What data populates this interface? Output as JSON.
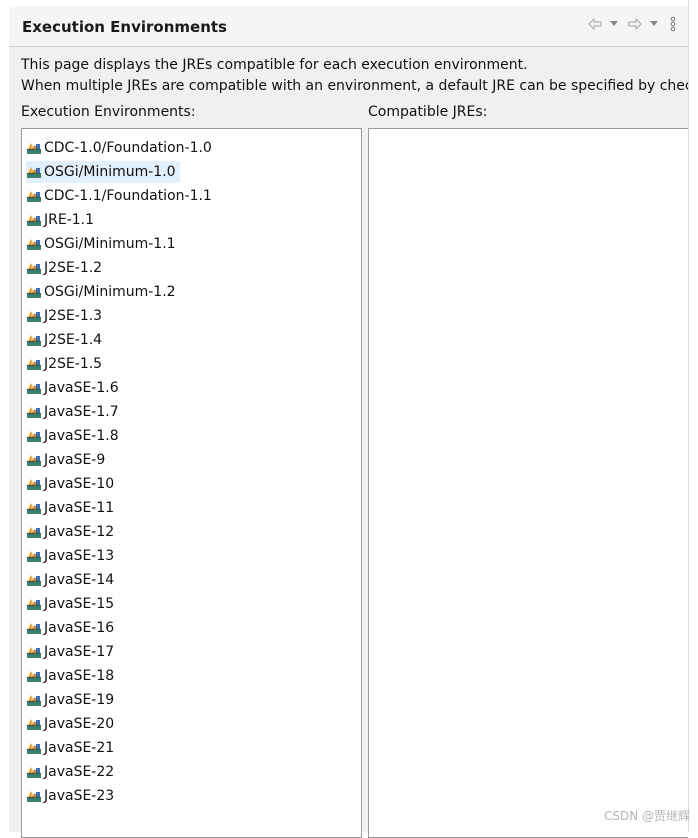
{
  "header": {
    "title": "Execution Environments"
  },
  "description": {
    "line1": "This page displays the JREs compatible for each execution environment.",
    "line2": "When multiple JREs are compatible with an environment, a default JRE can be specified by checking"
  },
  "environments_label": "Execution Environments:",
  "jres_label": "Compatible JREs:",
  "environments": [
    {
      "label": "CDC-1.0/Foundation-1.0",
      "selected": false
    },
    {
      "label": "OSGi/Minimum-1.0",
      "selected": true
    },
    {
      "label": "CDC-1.1/Foundation-1.1",
      "selected": false
    },
    {
      "label": "JRE-1.1",
      "selected": false
    },
    {
      "label": "OSGi/Minimum-1.1",
      "selected": false
    },
    {
      "label": "J2SE-1.2",
      "selected": false
    },
    {
      "label": "OSGi/Minimum-1.2",
      "selected": false
    },
    {
      "label": "J2SE-1.3",
      "selected": false
    },
    {
      "label": "J2SE-1.4",
      "selected": false
    },
    {
      "label": "J2SE-1.5",
      "selected": false
    },
    {
      "label": "JavaSE-1.6",
      "selected": false
    },
    {
      "label": "JavaSE-1.7",
      "selected": false
    },
    {
      "label": "JavaSE-1.8",
      "selected": false
    },
    {
      "label": "JavaSE-9",
      "selected": false
    },
    {
      "label": "JavaSE-10",
      "selected": false
    },
    {
      "label": "JavaSE-11",
      "selected": false
    },
    {
      "label": "JavaSE-12",
      "selected": false
    },
    {
      "label": "JavaSE-13",
      "selected": false
    },
    {
      "label": "JavaSE-14",
      "selected": false
    },
    {
      "label": "JavaSE-15",
      "selected": false
    },
    {
      "label": "JavaSE-16",
      "selected": false
    },
    {
      "label": "JavaSE-17",
      "selected": false
    },
    {
      "label": "JavaSE-18",
      "selected": false
    },
    {
      "label": "JavaSE-19",
      "selected": false
    },
    {
      "label": "JavaSE-20",
      "selected": false
    },
    {
      "label": "JavaSE-21",
      "selected": false
    },
    {
      "label": "JavaSE-22",
      "selected": false
    },
    {
      "label": "JavaSE-23",
      "selected": false
    }
  ],
  "compatible_jres": [],
  "icons": {
    "environment": "execution-environment-icon",
    "back": "back-arrow-icon",
    "forward": "forward-arrow-icon",
    "menu": "view-menu-icon"
  },
  "colors": {
    "selection": "#e2f0fc",
    "panel_bg": "#f0f0f0"
  },
  "watermark": "CSDN @贾继辉"
}
